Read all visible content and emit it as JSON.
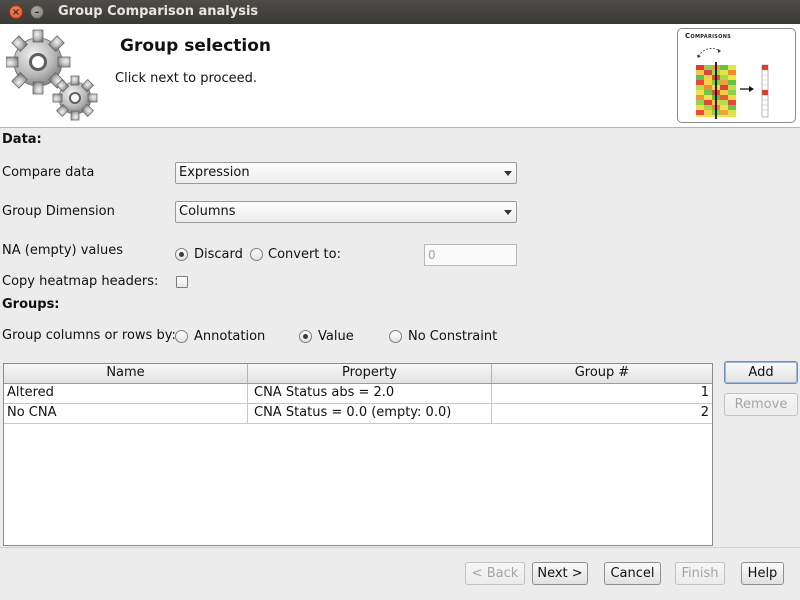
{
  "window": {
    "title": "Group Comparison analysis",
    "close_glyph": "×",
    "minimize_glyph": "–"
  },
  "header": {
    "title": "Group selection",
    "subtitle": "Click next to proceed.",
    "thumbnail_title": "Comparisons",
    "icon": "gears-icon"
  },
  "data_section": {
    "heading": "Data:",
    "compare_label": "Compare data",
    "compare_value": "Expression",
    "dimension_label": "Group Dimension",
    "dimension_value": "Columns",
    "na_label": "NA (empty) values",
    "na_discard": "Discard",
    "na_convert": "Convert to:",
    "na_selected": "Discard",
    "convert_placeholder": "0",
    "copy_headers_label": "Copy heatmap headers:",
    "copy_headers_checked": false
  },
  "groups_section": {
    "heading": "Groups:",
    "group_by_label": "Group columns or rows by:",
    "options": [
      "Annotation",
      "Value",
      "No Constraint"
    ],
    "selected": "Value"
  },
  "table": {
    "columns": [
      "Name",
      "Property",
      "Group #"
    ],
    "rows": [
      {
        "name": "Altered",
        "property": "CNA Status abs = 2.0",
        "group": "1"
      },
      {
        "name": "No CNA",
        "property": "CNA Status = 0.0 (empty: 0.0)",
        "group": "2"
      }
    ]
  },
  "side_buttons": {
    "add": "Add",
    "remove": "Remove"
  },
  "footer": {
    "back": "< Back",
    "next": "Next >",
    "cancel": "Cancel",
    "finish": "Finish",
    "help": "Help"
  },
  "colors": {
    "titlebar": "#3f3e3a",
    "close_button": "#e9602f",
    "focus_border": "#6f8fb8"
  }
}
